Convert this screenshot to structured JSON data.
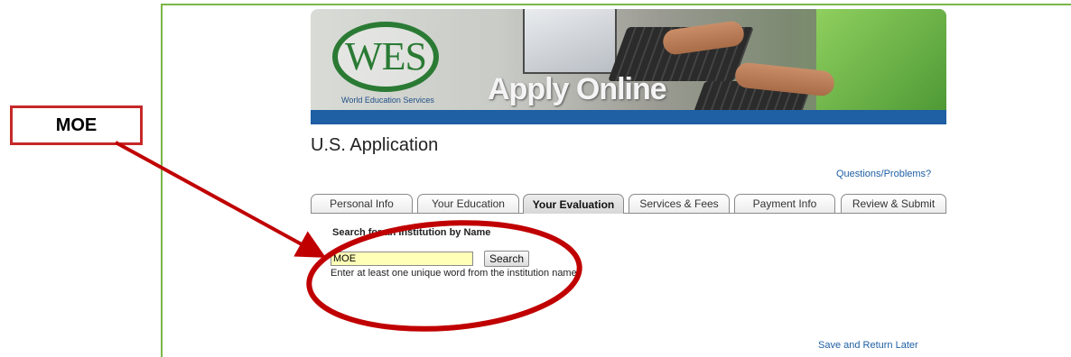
{
  "annotation": {
    "callout_label": "MOE",
    "accent_color": "#c62828"
  },
  "banner": {
    "logo_text": "WES",
    "logo_subtitle": "World Education Services",
    "tagline": "Apply Online",
    "strip_color": "#1f5fa3",
    "logo_color": "#2a7a34"
  },
  "page": {
    "title": "U.S. Application",
    "help_link": "Questions/Problems?",
    "save_link": "Save and Return Later"
  },
  "tabs": [
    {
      "label": "Personal Info",
      "active": false
    },
    {
      "label": "Your Education",
      "active": false
    },
    {
      "label": "Your Evaluation",
      "active": true
    },
    {
      "label": "Services & Fees",
      "active": false
    },
    {
      "label": "Payment Info",
      "active": false
    },
    {
      "label": "Review & Submit",
      "active": false
    }
  ],
  "search": {
    "heading": "Search for an Institution by Name",
    "input_value": "MOE",
    "button_label": "Search",
    "hint": "Enter at least one unique word from the institution name."
  },
  "colors": {
    "frame": "#7ab648",
    "link": "#1f5fa3",
    "input_bg": "#ffffb8"
  }
}
